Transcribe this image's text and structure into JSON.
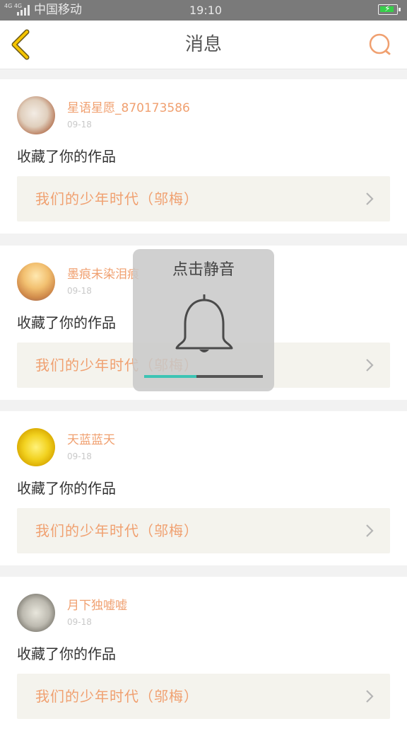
{
  "status_bar": {
    "network": "4G 4G",
    "carrier": "中国移动",
    "time": "19:10"
  },
  "nav": {
    "title": "消息"
  },
  "messages": [
    {
      "username": "星语星愿_870173586",
      "date": "09-18",
      "action": "收藏了你的作品",
      "work_title": "我们的少年时代（邬梅）"
    },
    {
      "username": "墨痕未染泪痕",
      "date": "09-18",
      "action": "收藏了你的作品",
      "work_title": "我们的少年时代（邬梅）"
    },
    {
      "username": "天蓝蓝天",
      "date": "09-18",
      "action": "收藏了你的作品",
      "work_title": "我们的少年时代（邬梅）"
    },
    {
      "username": "月下独嘘嘘",
      "date": "09-18",
      "action": "收藏了你的作品",
      "work_title": "我们的少年时代（邬梅）"
    }
  ],
  "overlay": {
    "text": "点击静音",
    "volume_level": 0.44
  },
  "colors": {
    "accent": "#f0a070",
    "back_icon": "#f5c400",
    "status_bar": "#7a7a7a",
    "battery": "#36d04a",
    "volume": "#3cc4b4"
  },
  "icons": [
    "back-arrow-icon",
    "search-icon",
    "chevron-right-icon",
    "bell-icon"
  ]
}
